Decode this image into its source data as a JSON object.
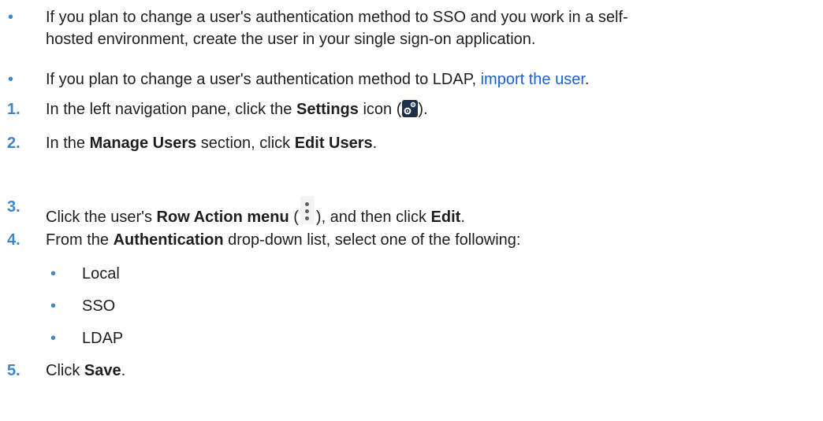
{
  "bullets": [
    {
      "marker": "•",
      "line1": "If you plan to change a user's authentication method to SSO and you work in a self-",
      "line2": "hosted environment, create the user in your single sign-on application."
    },
    {
      "marker": "•",
      "text_before": "If you plan to change a user's authentication method to LDAP, ",
      "link": "import the user",
      "text_after": "."
    }
  ],
  "steps": [
    {
      "number": "1.",
      "text_before": "In the left navigation pane, click the ",
      "bold": "Settings",
      "text_after": " icon (",
      "icon": "settings-gear-icon",
      "text_end": ")."
    },
    {
      "number": "2.",
      "text_before": "In the ",
      "bold1": "Manage Users",
      "text_middle": " section, click ",
      "bold2": "Edit Users",
      "text_after": "."
    },
    {
      "number": "3.",
      "text_before": "Click the user's ",
      "bold1": "Row Action menu",
      "text_middle1": " (",
      "icon": "kebab-menu-icon",
      "text_middle2": "), and then click ",
      "bold2": "Edit",
      "text_after": "."
    },
    {
      "number": "4.",
      "text_before": "From the ",
      "bold": "Authentication",
      "text_after": " drop-down list, select one of the following:",
      "options": [
        {
          "marker": "•",
          "label": "Local"
        },
        {
          "marker": "•",
          "label": "SSO"
        },
        {
          "marker": "•",
          "label": "LDAP"
        }
      ]
    },
    {
      "number": "5.",
      "text_before": "Click ",
      "bold": "Save",
      "text_after": "."
    }
  ],
  "colors": {
    "accent": "#3e86c7",
    "link": "#1d5fd6",
    "text": "#1e1e1e"
  }
}
